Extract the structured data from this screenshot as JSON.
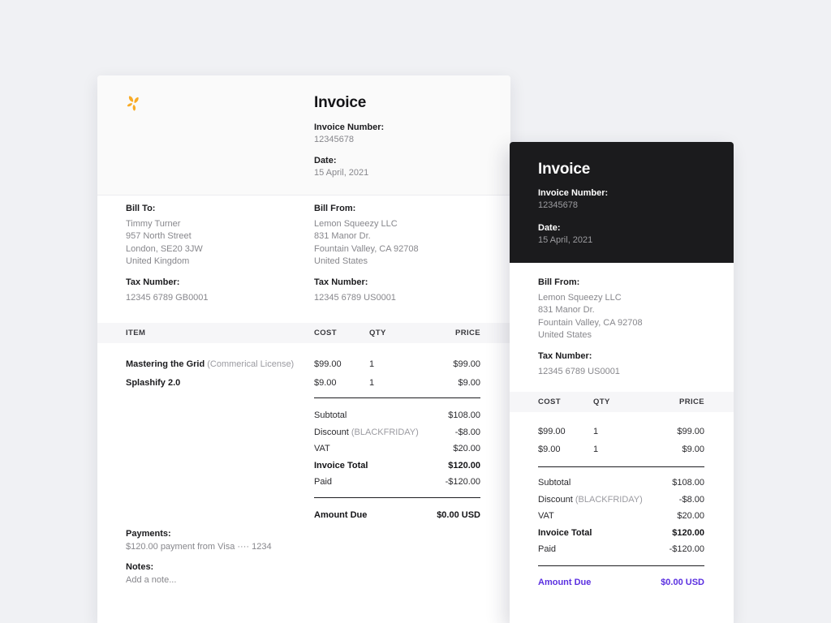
{
  "colors": {
    "canvas_bg": "#f0f1f4",
    "dark_header_bg": "#1b1b1d",
    "accent_purple": "#5a2fe0",
    "logo_orange": "#f8ab26"
  },
  "left_invoice": {
    "title": "Invoice",
    "invoice_number_label": "Invoice Number:",
    "invoice_number_value": "12345678",
    "date_label": "Date:",
    "date_value": "15 April, 2021",
    "bill_to_label": "Bill To:",
    "bill_to_lines": [
      "Timmy Turner",
      "957 North Street",
      "London, SE20 3JW",
      "United Kingdom"
    ],
    "bill_to_tax_label": "Tax Number:",
    "bill_to_tax_value": "12345 6789 GB0001",
    "bill_from_label": "Bill From:",
    "bill_from_lines": [
      "Lemon Squeezy LLC",
      "831 Manor Dr.",
      "Fountain Valley, CA 92708",
      "United States"
    ],
    "bill_from_tax_label": "Tax Number:",
    "bill_from_tax_value": "12345 6789 US0001",
    "table_headers": {
      "item": "ITEM",
      "cost": "COST",
      "qty": "QTY",
      "price": "PRICE"
    },
    "items": [
      {
        "name": "Mastering the Grid",
        "note": "(Commerical License)",
        "cost": "$99.00",
        "qty": "1",
        "price": "$99.00"
      },
      {
        "name": "Splashify 2.0",
        "note": "",
        "cost": "$9.00",
        "qty": "1",
        "price": "$9.00"
      }
    ],
    "totals": [
      {
        "label": "Subtotal",
        "note": "",
        "value": "$108.00"
      },
      {
        "label": "Discount",
        "note": "(BLACKFRIDAY)",
        "value": "-$8.00"
      },
      {
        "label": "VAT",
        "note": "",
        "value": "$20.00"
      },
      {
        "label": "Invoice Total",
        "note": "",
        "value": "$120.00"
      },
      {
        "label": "Paid",
        "note": "",
        "value": "-$120.00"
      }
    ],
    "amount_due_label": "Amount Due",
    "amount_due_value": "$0.00 USD",
    "payments_label": "Payments:",
    "payments_value": "$120.00 payment from Visa ···· 1234",
    "notes_label": "Notes:",
    "notes_placeholder": "Add a note..."
  },
  "right_invoice": {
    "title": "Invoice",
    "invoice_number_label": "Invoice Number:",
    "invoice_number_value": "12345678",
    "date_label": "Date:",
    "date_value": "15 April, 2021",
    "bill_from_label": "Bill From:",
    "bill_from_lines": [
      "Lemon Squeezy LLC",
      "831 Manor Dr.",
      "Fountain Valley, CA 92708",
      "United States"
    ],
    "bill_from_tax_label": "Tax Number:",
    "bill_from_tax_value": "12345 6789 US0001",
    "table_headers": {
      "cost": "COST",
      "qty": "QTY",
      "price": "PRICE"
    },
    "items": [
      {
        "cost": "$99.00",
        "qty": "1",
        "price": "$99.00"
      },
      {
        "cost": "$9.00",
        "qty": "1",
        "price": "$9.00"
      }
    ],
    "totals": [
      {
        "label": "Subtotal",
        "note": "",
        "value": "$108.00"
      },
      {
        "label": "Discount",
        "note": "(BLACKFRIDAY)",
        "value": "-$8.00"
      },
      {
        "label": "VAT",
        "note": "",
        "value": "$20.00"
      },
      {
        "label": "Invoice Total",
        "note": "",
        "value": "$120.00"
      },
      {
        "label": "Paid",
        "note": "",
        "value": "-$120.00"
      }
    ],
    "amount_due_label": "Amount Due",
    "amount_due_value": "$0.00 USD"
  }
}
